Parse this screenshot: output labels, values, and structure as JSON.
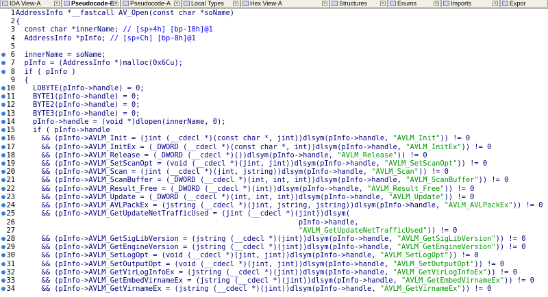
{
  "tabs": [
    {
      "label": "IDA View-A",
      "active": false
    },
    {
      "label": "Pseudocode-B",
      "active": true
    },
    {
      "label": "Pseudocode-A",
      "active": false
    },
    {
      "label": "Local Types",
      "active": false
    },
    {
      "label": "Hex View-A",
      "active": false
    },
    {
      "label": "Structures",
      "active": false
    },
    {
      "label": "Enums",
      "active": false
    },
    {
      "label": "Imports",
      "active": false
    },
    {
      "label": "Expor",
      "active": false
    }
  ],
  "code_lines": [
    {
      "n": "1",
      "bp": false,
      "text": "AddressInfo *__fastcall AV_Open(const char *soName)"
    },
    {
      "n": "2",
      "bp": false,
      "text": "{"
    },
    {
      "n": "3",
      "bp": false,
      "text": "  const char *innerName; // [sp+4h] [bp-10h]@1"
    },
    {
      "n": "4",
      "bp": false,
      "text": "  AddressInfo *pInfo; // [sp+Ch] [bp-8h]@1"
    },
    {
      "n": "5",
      "bp": false,
      "text": ""
    },
    {
      "n": "6",
      "bp": true,
      "text": "  innerName = soName;"
    },
    {
      "n": "7",
      "bp": true,
      "text": "  pInfo = (AddressInfo *)malloc(0x6Cu);"
    },
    {
      "n": "8",
      "bp": true,
      "text": "  if ( pInfo )"
    },
    {
      "n": "9",
      "bp": false,
      "text": "  {"
    },
    {
      "n": "10",
      "bp": true,
      "text": "    LOBYTE(pInfo->handle) = 0;"
    },
    {
      "n": "11",
      "bp": true,
      "text": "    BYTE1(pInfo->handle) = 0;"
    },
    {
      "n": "12",
      "bp": true,
      "text": "    BYTE2(pInfo->handle) = 0;"
    },
    {
      "n": "13",
      "bp": true,
      "text": "    BYTE3(pInfo->handle) = 0;"
    },
    {
      "n": "14",
      "bp": true,
      "text": "    pInfo->handle = (void *)dlopen(innerName, 0);"
    },
    {
      "n": "15",
      "bp": true,
      "text": "    if ( pInfo->handle"
    },
    {
      "n": "16",
      "bp": true,
      "text": "      && (pInfo->AVLM_Init = (jint (__cdecl *)(const char *, jint))dlsym(pInfo->handle, \"AVLM_Init\")) != 0"
    },
    {
      "n": "17",
      "bp": true,
      "text": "      && (pInfo->AVLM_InitEx = (_DWORD (__cdecl *)(const char *, int))dlsym(pInfo->handle, \"AVLM_InitEx\")) != 0"
    },
    {
      "n": "18",
      "bp": true,
      "text": "      && (pInfo->AVLM_Release = (_DWORD (__cdecl *)())dlsym(pInfo->handle, \"AVLM_Release\")) != 0"
    },
    {
      "n": "19",
      "bp": true,
      "text": "      && (pInfo->AVLM_SetScanOpt = (void (__cdecl *)(jint, jint))dlsym(pInfo->handle, \"AVLM_SetScanOpt\")) != 0"
    },
    {
      "n": "20",
      "bp": true,
      "text": "      && (pInfo->AVLM_Scan = (jint (__cdecl *)(jint, jstring))dlsym(pInfo->handle, \"AVLM_Scan\")) != 0"
    },
    {
      "n": "21",
      "bp": true,
      "text": "      && (pInfo->AVLM_ScanBuffer = (_DWORD (__cdecl *)(int, int, int))dlsym(pInfo->handle, \"AVLM_ScanBuffer\")) != 0"
    },
    {
      "n": "22",
      "bp": true,
      "text": "      && (pInfo->AVLM_Result_Free = (_DWORD (__cdecl *)(int))dlsym(pInfo->handle, \"AVLM_Result_Free\")) != 0"
    },
    {
      "n": "23",
      "bp": true,
      "text": "      && (pInfo->AVLM_Update = (_DWORD (__cdecl *)(int, int, int))dlsym(pInfo->handle, \"AVLM_Update\")) != 0"
    },
    {
      "n": "24",
      "bp": true,
      "text": "      && (pInfo->AVLM_AVLPackEx = (jstring (__cdecl *)(jint, jstring, jstring))dlsym(pInfo->handle, \"AVLM_AVLPackEx\")) != 0"
    },
    {
      "n": "25",
      "bp": true,
      "text": "      && (pInfo->AVLM_GetUpdateNetTrafficUsed = (jint (__cdecl *)(jint))dlsym("
    },
    {
      "n": "26",
      "bp": false,
      "text": "                                                                  pInfo->handle,"
    },
    {
      "n": "27",
      "bp": false,
      "text": "                                                                  \"AVLM_GetUpdateNetTrafficUsed\")) != 0"
    },
    {
      "n": "28",
      "bp": true,
      "text": "      && (pInfo->AVLM_GetSigLibVersion = (jstring (__cdecl *)(jint))dlsym(pInfo->handle, \"AVLM_GetSigLibVersion\")) != 0"
    },
    {
      "n": "29",
      "bp": true,
      "text": "      && (pInfo->AVLM_GetEngineVersion = (jstring (__cdecl *)(jint))dlsym(pInfo->handle, \"AVLM_GetEngineVersion\")) != 0"
    },
    {
      "n": "30",
      "bp": true,
      "text": "      && (pInfo->AVLM_SetLogOpt = (void (__cdecl *)(jint, jint))dlsym(pInfo->handle, \"AVLM_SetLogOpt\")) != 0"
    },
    {
      "n": "31",
      "bp": true,
      "text": "      && (pInfo->AVLM_SetOutputOpt = (void (__cdecl *)(jint, jint))dlsym(pInfo->handle, \"AVLM_SetOutputOpt\")) != 0"
    },
    {
      "n": "32",
      "bp": true,
      "text": "      && (pInfo->AVLM_GetVirLogInfoEx = (jstring (__cdecl *)(jint))dlsym(pInfo->handle, \"AVLM_GetVirLogInfoEx\")) != 0"
    },
    {
      "n": "33",
      "bp": true,
      "text": "      && (pInfo->AVLM_GetEmbedVirnameEx = (jstring (__cdecl *)(jint))dlsym(pInfo->handle, \"AVLM_GetEmbedVirnameEx\")) != 0"
    },
    {
      "n": "34",
      "bp": true,
      "text": "      && (pInfo->AVLM_GetVirnameEx = (jstring (__cdecl *)(jint))dlsym(pInfo->handle, \"AVLM_GetVirnameEx\")) != 0"
    }
  ],
  "colors": {
    "code": "#000080",
    "string": "#009900",
    "comment": "#0000ff",
    "breakpoint": "#3a7bd5"
  }
}
